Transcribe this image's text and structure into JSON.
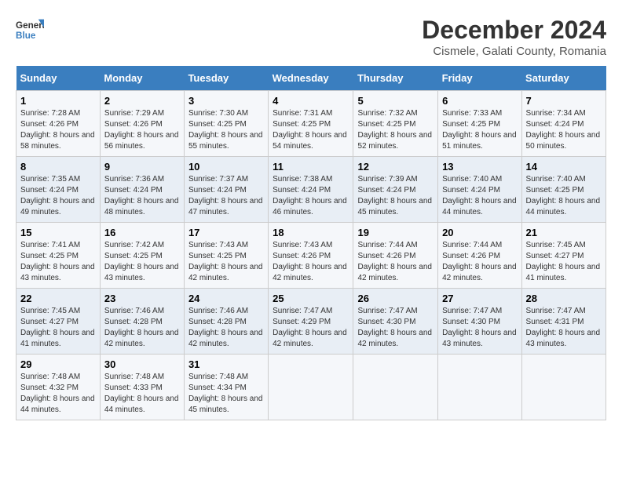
{
  "logo": {
    "line1": "General",
    "line2": "Blue"
  },
  "title": "December 2024",
  "subtitle": "Cismele, Galati County, Romania",
  "headers": [
    "Sunday",
    "Monday",
    "Tuesday",
    "Wednesday",
    "Thursday",
    "Friday",
    "Saturday"
  ],
  "weeks": [
    [
      {
        "day": "1",
        "sunrise": "7:28 AM",
        "sunset": "4:26 PM",
        "daylight": "8 hours and 58 minutes."
      },
      {
        "day": "2",
        "sunrise": "7:29 AM",
        "sunset": "4:26 PM",
        "daylight": "8 hours and 56 minutes."
      },
      {
        "day": "3",
        "sunrise": "7:30 AM",
        "sunset": "4:25 PM",
        "daylight": "8 hours and 55 minutes."
      },
      {
        "day": "4",
        "sunrise": "7:31 AM",
        "sunset": "4:25 PM",
        "daylight": "8 hours and 54 minutes."
      },
      {
        "day": "5",
        "sunrise": "7:32 AM",
        "sunset": "4:25 PM",
        "daylight": "8 hours and 52 minutes."
      },
      {
        "day": "6",
        "sunrise": "7:33 AM",
        "sunset": "4:25 PM",
        "daylight": "8 hours and 51 minutes."
      },
      {
        "day": "7",
        "sunrise": "7:34 AM",
        "sunset": "4:24 PM",
        "daylight": "8 hours and 50 minutes."
      }
    ],
    [
      {
        "day": "8",
        "sunrise": "7:35 AM",
        "sunset": "4:24 PM",
        "daylight": "8 hours and 49 minutes."
      },
      {
        "day": "9",
        "sunrise": "7:36 AM",
        "sunset": "4:24 PM",
        "daylight": "8 hours and 48 minutes."
      },
      {
        "day": "10",
        "sunrise": "7:37 AM",
        "sunset": "4:24 PM",
        "daylight": "8 hours and 47 minutes."
      },
      {
        "day": "11",
        "sunrise": "7:38 AM",
        "sunset": "4:24 PM",
        "daylight": "8 hours and 46 minutes."
      },
      {
        "day": "12",
        "sunrise": "7:39 AM",
        "sunset": "4:24 PM",
        "daylight": "8 hours and 45 minutes."
      },
      {
        "day": "13",
        "sunrise": "7:40 AM",
        "sunset": "4:24 PM",
        "daylight": "8 hours and 44 minutes."
      },
      {
        "day": "14",
        "sunrise": "7:40 AM",
        "sunset": "4:25 PM",
        "daylight": "8 hours and 44 minutes."
      }
    ],
    [
      {
        "day": "15",
        "sunrise": "7:41 AM",
        "sunset": "4:25 PM",
        "daylight": "8 hours and 43 minutes."
      },
      {
        "day": "16",
        "sunrise": "7:42 AM",
        "sunset": "4:25 PM",
        "daylight": "8 hours and 43 minutes."
      },
      {
        "day": "17",
        "sunrise": "7:43 AM",
        "sunset": "4:25 PM",
        "daylight": "8 hours and 42 minutes."
      },
      {
        "day": "18",
        "sunrise": "7:43 AM",
        "sunset": "4:26 PM",
        "daylight": "8 hours and 42 minutes."
      },
      {
        "day": "19",
        "sunrise": "7:44 AM",
        "sunset": "4:26 PM",
        "daylight": "8 hours and 42 minutes."
      },
      {
        "day": "20",
        "sunrise": "7:44 AM",
        "sunset": "4:26 PM",
        "daylight": "8 hours and 42 minutes."
      },
      {
        "day": "21",
        "sunrise": "7:45 AM",
        "sunset": "4:27 PM",
        "daylight": "8 hours and 41 minutes."
      }
    ],
    [
      {
        "day": "22",
        "sunrise": "7:45 AM",
        "sunset": "4:27 PM",
        "daylight": "8 hours and 41 minutes."
      },
      {
        "day": "23",
        "sunrise": "7:46 AM",
        "sunset": "4:28 PM",
        "daylight": "8 hours and 42 minutes."
      },
      {
        "day": "24",
        "sunrise": "7:46 AM",
        "sunset": "4:28 PM",
        "daylight": "8 hours and 42 minutes."
      },
      {
        "day": "25",
        "sunrise": "7:47 AM",
        "sunset": "4:29 PM",
        "daylight": "8 hours and 42 minutes."
      },
      {
        "day": "26",
        "sunrise": "7:47 AM",
        "sunset": "4:30 PM",
        "daylight": "8 hours and 42 minutes."
      },
      {
        "day": "27",
        "sunrise": "7:47 AM",
        "sunset": "4:30 PM",
        "daylight": "8 hours and 43 minutes."
      },
      {
        "day": "28",
        "sunrise": "7:47 AM",
        "sunset": "4:31 PM",
        "daylight": "8 hours and 43 minutes."
      }
    ],
    [
      {
        "day": "29",
        "sunrise": "7:48 AM",
        "sunset": "4:32 PM",
        "daylight": "8 hours and 44 minutes."
      },
      {
        "day": "30",
        "sunrise": "7:48 AM",
        "sunset": "4:33 PM",
        "daylight": "8 hours and 44 minutes."
      },
      {
        "day": "31",
        "sunrise": "7:48 AM",
        "sunset": "4:34 PM",
        "daylight": "8 hours and 45 minutes."
      },
      null,
      null,
      null,
      null
    ]
  ]
}
